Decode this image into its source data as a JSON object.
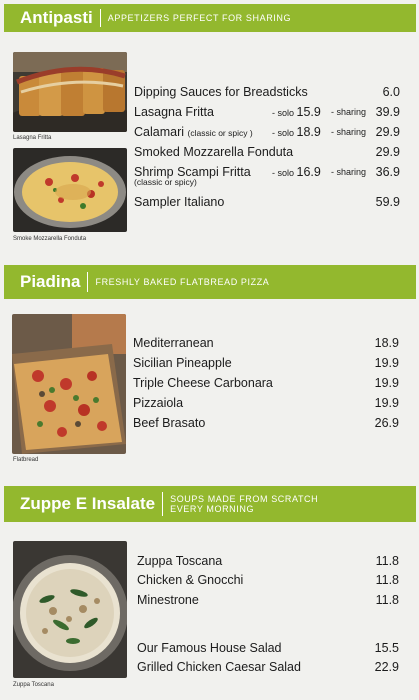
{
  "sections": [
    {
      "title": "Antipasti",
      "subtitle": "APPETIZERS PERFECT FOR SHARING",
      "photos": [
        {
          "caption": "Lasagna Fritta"
        },
        {
          "caption": "Smoke Mozzarella Fonduta"
        }
      ],
      "items": [
        {
          "name": "Dipping Sauces for Breadsticks",
          "price": "6.0"
        },
        {
          "name": "Lasagna Fritta",
          "solo_label": "- solo",
          "solo_price": "15.9",
          "sharing_label": "- sharing",
          "price": "39.9"
        },
        {
          "name": "Calamari",
          "variant": "(classic or spicy )",
          "solo_label": "- solo",
          "solo_price": "18.9",
          "sharing_label": "- sharing",
          "price": "29.9"
        },
        {
          "name": "Smoked Mozzarella Fonduta",
          "price": "29.9"
        },
        {
          "name": "Shrimp Scampi Fritta",
          "variant": "(classic or spicy)",
          "solo_label": "- solo",
          "solo_price": "16.9",
          "sharing_label": "- sharing",
          "price": "36.9"
        },
        {
          "name": "Sampler Italiano",
          "price": "59.9"
        }
      ]
    },
    {
      "title": "Piadina",
      "subtitle": "FRESHLY BAKED FLATBREAD PIZZA",
      "photos": [
        {
          "caption": "Flatbread"
        }
      ],
      "items": [
        {
          "name": "Mediterranean",
          "price": "18.9"
        },
        {
          "name": "Sicilian Pineapple",
          "price": "19.9"
        },
        {
          "name": "Triple Cheese Carbonara",
          "price": "19.9"
        },
        {
          "name": "Pizzaiola",
          "price": "19.9"
        },
        {
          "name": "Beef Brasato",
          "price": "26.9"
        }
      ]
    },
    {
      "title": "Zuppe E Insalate",
      "subtitle_line1": "SOUPS MADE FROM SCRATCH",
      "subtitle_line2": "EVERY MORNING",
      "photos": [
        {
          "caption": "Zuppa Toscana"
        }
      ],
      "items": [
        {
          "name": "Zuppa Toscana",
          "price": "11.8"
        },
        {
          "name": "Chicken & Gnocchi",
          "price": "11.8"
        },
        {
          "name": "Minestrone",
          "price": "11.8"
        },
        {
          "name": "Our Famous House Salad",
          "price": "15.5"
        },
        {
          "name": "Grilled Chicken Caesar Salad",
          "price": "22.9"
        }
      ]
    }
  ],
  "colors": {
    "accent": "#93b82e",
    "background": "#f1f1ee",
    "text": "#1c1c1c"
  }
}
